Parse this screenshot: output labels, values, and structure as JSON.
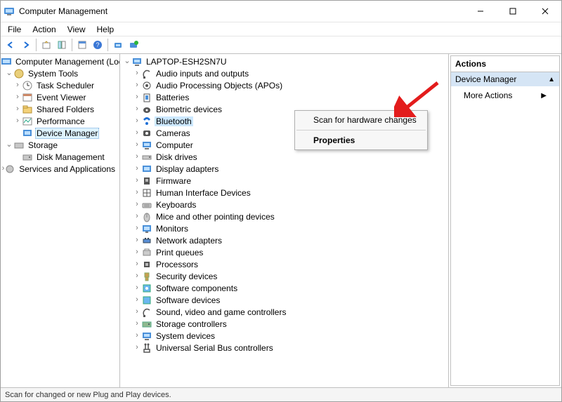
{
  "window": {
    "title": "Computer Management"
  },
  "menus": [
    "File",
    "Action",
    "View",
    "Help"
  ],
  "toolbar_icons": [
    "back-icon",
    "forward-icon",
    "up-icon",
    "tree-icon",
    "list-icon",
    "detail-icon",
    "help-icon",
    "refresh-icon",
    "scan-icon"
  ],
  "left_tree": {
    "root": "Computer Management (Local)",
    "groups": [
      {
        "label": "System Tools",
        "expanded": true,
        "items": [
          "Task Scheduler",
          "Event Viewer",
          "Shared Folders",
          "Performance",
          "Device Manager"
        ],
        "selected_index": 4
      },
      {
        "label": "Storage",
        "expanded": true,
        "items": [
          "Disk Management"
        ]
      },
      {
        "label": "Services and Applications",
        "expanded": false,
        "items": []
      }
    ]
  },
  "device_tree": {
    "root": "LAPTOP-ESH2SN7U",
    "categories": [
      "Audio inputs and outputs",
      "Audio Processing Objects (APOs)",
      "Batteries",
      "Biometric devices",
      "Bluetooth",
      "Cameras",
      "Computer",
      "Disk drives",
      "Display adapters",
      "Firmware",
      "Human Interface Devices",
      "Keyboards",
      "Mice and other pointing devices",
      "Monitors",
      "Network adapters",
      "Print queues",
      "Processors",
      "Security devices",
      "Software components",
      "Software devices",
      "Sound, video and game controllers",
      "Storage controllers",
      "System devices",
      "Universal Serial Bus controllers"
    ],
    "highlighted_index": 4
  },
  "context_menu": {
    "items": [
      "Scan for hardware changes",
      "Properties"
    ],
    "default_index": 1
  },
  "actions_pane": {
    "header": "Actions",
    "section": "Device Manager",
    "row": "More Actions"
  },
  "statusbar": "Scan for changed or new Plug and Play devices.",
  "colors": {
    "highlight": "#cce8ff",
    "pane_section": "#d5e5f5"
  }
}
